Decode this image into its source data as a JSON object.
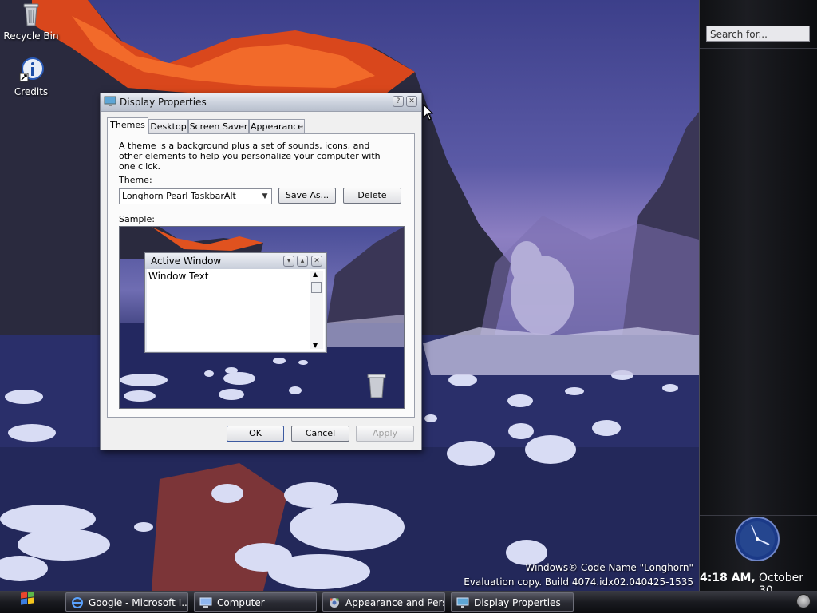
{
  "desktop": {
    "icons": [
      {
        "label": "Recycle Bin",
        "icon": "recycle-bin-icon"
      },
      {
        "label": "Credits",
        "icon": "info-icon"
      }
    ],
    "watermark_line1": "Windows® Code Name \"Longhorn\"",
    "watermark_line2": "Evaluation copy. Build 4074.idx02.040425-1535"
  },
  "sidebar": {
    "search_placeholder": "Search for...",
    "clock_icon": "analog-clock-icon"
  },
  "taskbar": {
    "time": "4:18 AM,",
    "date": "October 30",
    "tasks": [
      {
        "label": "Google - Microsoft I...",
        "icon": "ie-icon"
      },
      {
        "label": "Computer",
        "icon": "computer-icon"
      },
      {
        "label": "Appearance and Pers...",
        "icon": "appearance-icon"
      },
      {
        "label": "Display Properties",
        "icon": "display-icon"
      }
    ]
  },
  "dialog": {
    "title": "Display Properties",
    "tabs": [
      "Themes",
      "Desktop",
      "Screen Saver",
      "Appearance"
    ],
    "active_tab": "Themes",
    "description": "A theme is a background plus a set of sounds, icons, and other elements to help you personalize your computer with one click.",
    "theme_label": "Theme:",
    "theme_value": "Longhorn Pearl TaskbarAlt",
    "save_as": "Save As...",
    "delete": "Delete",
    "sample_label": "Sample:",
    "sample_window_title": "Active Window",
    "sample_window_text": "Window Text",
    "ok": "OK",
    "cancel": "Cancel",
    "apply": "Apply"
  }
}
